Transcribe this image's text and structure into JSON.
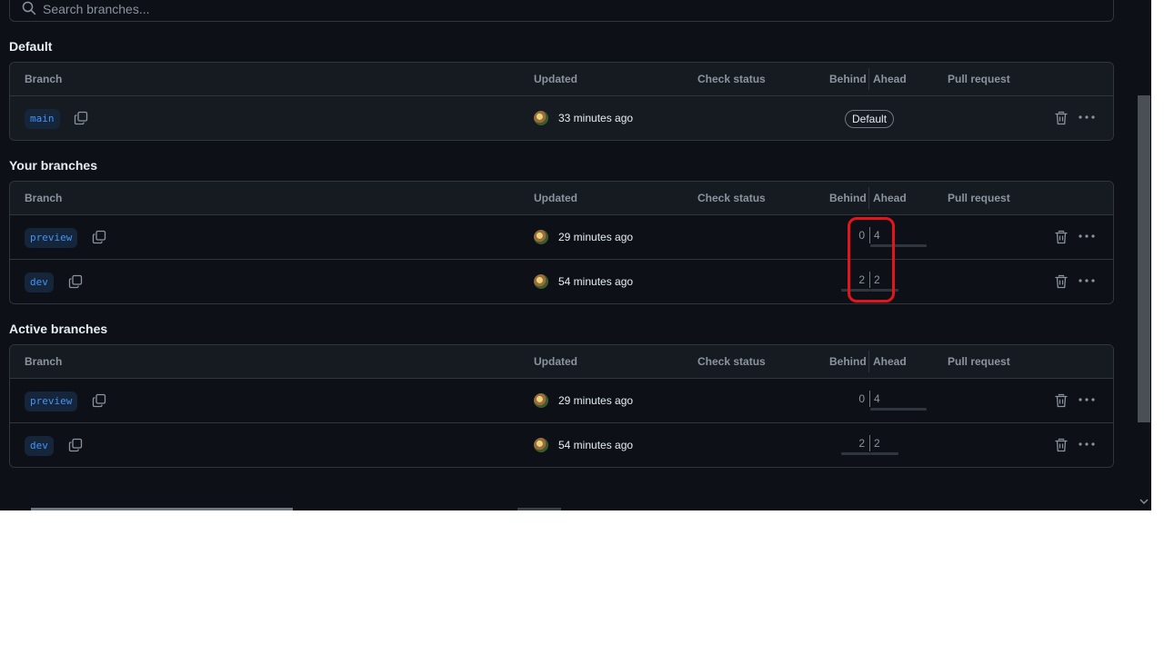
{
  "search": {
    "placeholder": "Search branches...",
    "icon": "search-icon"
  },
  "headers": {
    "branch": "Branch",
    "updated": "Updated",
    "check_status": "Check status",
    "behind": "Behind",
    "ahead": "Ahead",
    "pull_request": "Pull request"
  },
  "sections": {
    "default": {
      "title": "Default",
      "rows": [
        {
          "branch": "main",
          "updated": "33 minutes ago",
          "badge": "Default"
        }
      ]
    },
    "yours": {
      "title": "Your branches",
      "rows": [
        {
          "branch": "preview",
          "updated": "29 minutes ago",
          "behind": "0",
          "ahead": "4"
        },
        {
          "branch": "dev",
          "updated": "54 minutes ago",
          "behind": "2",
          "ahead": "2"
        }
      ]
    },
    "active": {
      "title": "Active branches",
      "rows": [
        {
          "branch": "preview",
          "updated": "29 minutes ago",
          "behind": "0",
          "ahead": "4"
        },
        {
          "branch": "dev",
          "updated": "54 minutes ago",
          "behind": "2",
          "ahead": "2"
        }
      ]
    }
  },
  "colors": {
    "background": "#0d1117",
    "border": "#30363d",
    "branch_text": "#4493f8",
    "highlight": "#e5141a"
  }
}
